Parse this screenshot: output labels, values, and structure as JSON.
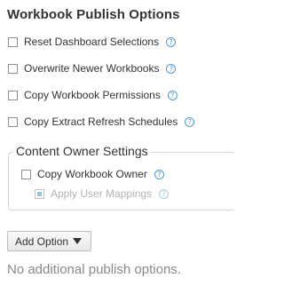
{
  "title": "Workbook Publish Options",
  "options": [
    {
      "label": "Reset Dashboard Selections",
      "checked": false
    },
    {
      "label": "Overwrite Newer Workbooks",
      "checked": false
    },
    {
      "label": "Copy Workbook Permissions",
      "checked": false
    },
    {
      "label": "Copy Extract Refresh Schedules",
      "checked": false
    }
  ],
  "content_owner": {
    "legend": "Content Owner Settings",
    "copy_owner": {
      "label": "Copy Workbook Owner",
      "checked": false
    },
    "apply_mappings": {
      "label": "Apply User Mappings",
      "checked": true,
      "disabled": true
    }
  },
  "help_glyph": "?",
  "add_option": {
    "label": "Add Option"
  },
  "empty_note": "No additional publish options.",
  "colors": {
    "help_blue": "#4c9bd1",
    "disabled_check": "#9ec3de",
    "muted_text": "#8a8a8a"
  },
  "icons": {
    "help": "question-circle-icon",
    "dropdown": "caret-down-icon"
  }
}
